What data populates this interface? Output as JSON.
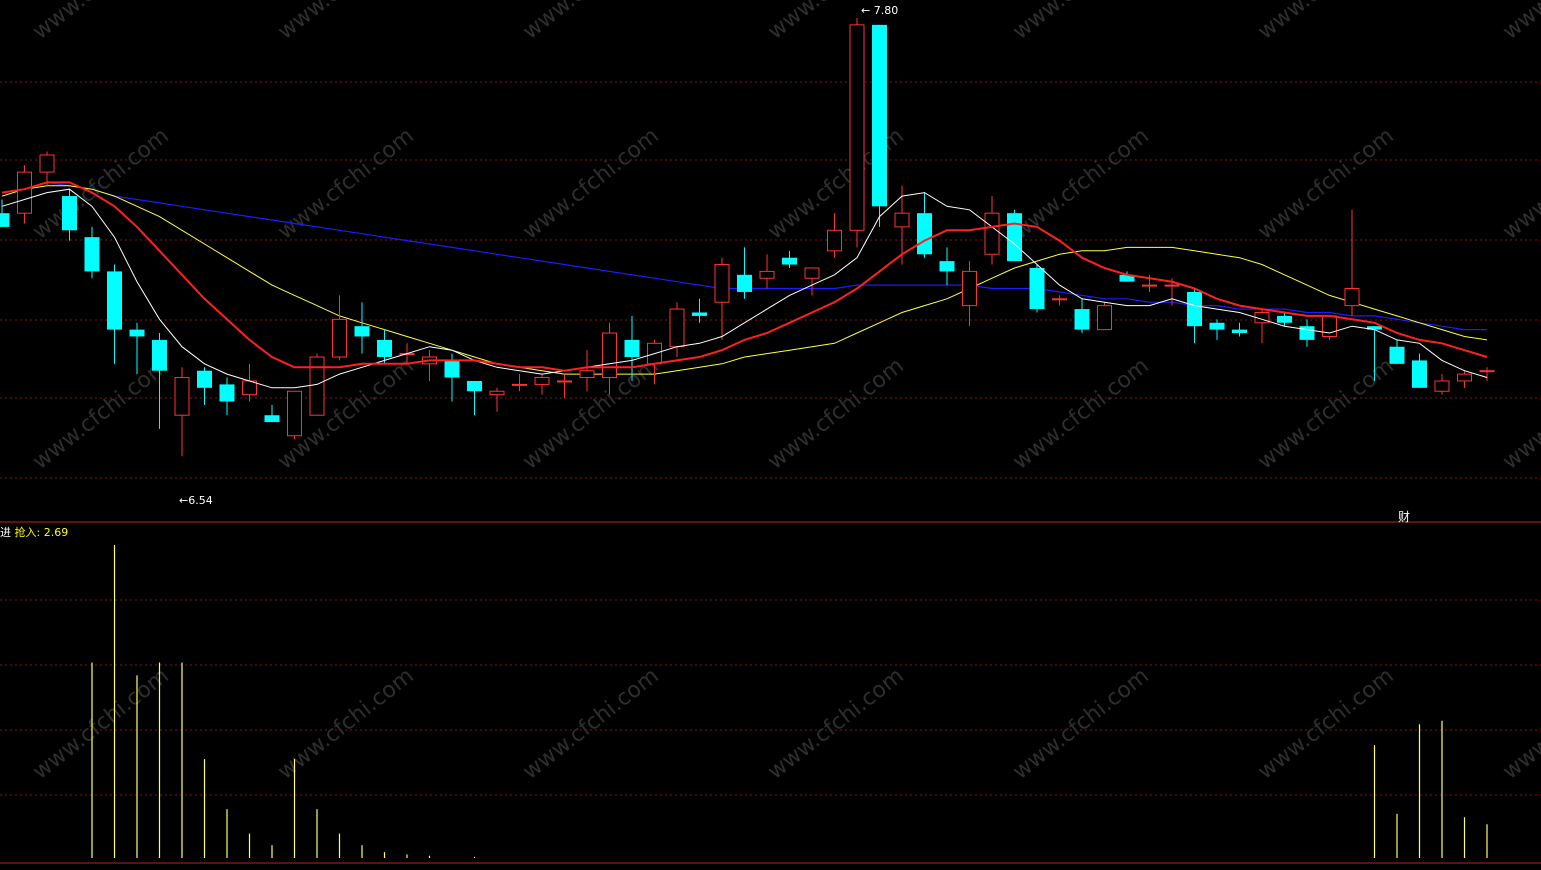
{
  "labels": {
    "indicator_head": "进",
    "indicator_name": "抢入:",
    "indicator_value": "2.69",
    "high_note": "← 7.80",
    "low_note": "←6.54",
    "finance_mark": "财",
    "watermark": "www.cfchi.com"
  },
  "colors": {
    "background": "#000000",
    "up": "#ff3232",
    "down": "#00ffff",
    "ma_white": "#ffffff",
    "ma_red": "#ff2020",
    "ma_yellow": "#ffff40",
    "ma_blue": "#1c1cff",
    "volume_bar": "#ffff66",
    "grid": "#7a1a1a",
    "divider": "#c02020"
  },
  "chart_data": [
    {
      "type": "candlestick",
      "price_range": [
        6.5,
        7.82
      ],
      "candles": [
        {
          "o": 7.25,
          "h": 7.29,
          "l": 7.21,
          "c": 7.21
        },
        {
          "o": 7.25,
          "h": 7.39,
          "l": 7.22,
          "c": 7.37
        },
        {
          "o": 7.37,
          "h": 7.43,
          "l": 7.33,
          "c": 7.42
        },
        {
          "o": 7.3,
          "h": 7.32,
          "l": 7.17,
          "c": 7.2
        },
        {
          "o": 7.18,
          "h": 7.21,
          "l": 7.06,
          "c": 7.08
        },
        {
          "o": 7.08,
          "h": 7.1,
          "l": 6.81,
          "c": 6.91
        },
        {
          "o": 6.91,
          "h": 6.93,
          "l": 6.78,
          "c": 6.89
        },
        {
          "o": 6.88,
          "h": 6.9,
          "l": 6.62,
          "c": 6.79
        },
        {
          "o": 6.66,
          "h": 6.8,
          "l": 6.54,
          "c": 6.77
        },
        {
          "o": 6.79,
          "h": 6.8,
          "l": 6.69,
          "c": 6.74
        },
        {
          "o": 6.75,
          "h": 6.77,
          "l": 6.66,
          "c": 6.7
        },
        {
          "o": 6.72,
          "h": 6.81,
          "l": 6.7,
          "c": 6.76
        },
        {
          "o": 6.66,
          "h": 6.69,
          "l": 6.64,
          "c": 6.64
        },
        {
          "o": 6.6,
          "h": 6.73,
          "l": 6.59,
          "c": 6.73
        },
        {
          "o": 6.66,
          "h": 6.84,
          "l": 6.66,
          "c": 6.83
        },
        {
          "o": 6.83,
          "h": 7.01,
          "l": 6.82,
          "c": 6.94
        },
        {
          "o": 6.92,
          "h": 6.99,
          "l": 6.84,
          "c": 6.89
        },
        {
          "o": 6.88,
          "h": 6.91,
          "l": 6.81,
          "c": 6.83
        },
        {
          "o": 6.84,
          "h": 6.87,
          "l": 6.81,
          "c": 6.84
        },
        {
          "o": 6.81,
          "h": 6.85,
          "l": 6.76,
          "c": 6.83
        },
        {
          "o": 6.82,
          "h": 6.84,
          "l": 6.7,
          "c": 6.77
        },
        {
          "o": 6.76,
          "h": 6.76,
          "l": 6.66,
          "c": 6.73
        },
        {
          "o": 6.72,
          "h": 6.74,
          "l": 6.67,
          "c": 6.73
        },
        {
          "o": 6.75,
          "h": 6.78,
          "l": 6.73,
          "c": 6.75
        },
        {
          "o": 6.75,
          "h": 6.78,
          "l": 6.72,
          "c": 6.77
        },
        {
          "o": 6.76,
          "h": 6.78,
          "l": 6.71,
          "c": 6.76
        },
        {
          "o": 6.77,
          "h": 6.85,
          "l": 6.73,
          "c": 6.79
        },
        {
          "o": 6.77,
          "h": 6.93,
          "l": 6.72,
          "c": 6.9
        },
        {
          "o": 6.88,
          "h": 6.95,
          "l": 6.76,
          "c": 6.83
        },
        {
          "o": 6.81,
          "h": 6.88,
          "l": 6.75,
          "c": 6.87
        },
        {
          "o": 6.86,
          "h": 6.99,
          "l": 6.83,
          "c": 6.97
        },
        {
          "o": 6.96,
          "h": 7.0,
          "l": 6.93,
          "c": 6.95
        },
        {
          "o": 6.99,
          "h": 7.12,
          "l": 6.88,
          "c": 7.1
        },
        {
          "o": 7.07,
          "h": 7.15,
          "l": 7.0,
          "c": 7.02
        },
        {
          "o": 7.06,
          "h": 7.13,
          "l": 7.03,
          "c": 7.08
        },
        {
          "o": 7.12,
          "h": 7.14,
          "l": 7.09,
          "c": 7.1
        },
        {
          "o": 7.06,
          "h": 7.09,
          "l": 7.01,
          "c": 7.09
        },
        {
          "o": 7.14,
          "h": 7.25,
          "l": 7.12,
          "c": 7.2
        },
        {
          "o": 7.2,
          "h": 7.82,
          "l": 7.15,
          "c": 7.8
        },
        {
          "o": 7.8,
          "h": 7.8,
          "l": 7.21,
          "c": 7.27
        },
        {
          "o": 7.21,
          "h": 7.33,
          "l": 7.1,
          "c": 7.25
        },
        {
          "o": 7.25,
          "h": 7.31,
          "l": 7.12,
          "c": 7.13
        },
        {
          "o": 7.11,
          "h": 7.15,
          "l": 7.04,
          "c": 7.08
        },
        {
          "o": 6.98,
          "h": 7.11,
          "l": 6.92,
          "c": 7.08
        },
        {
          "o": 7.13,
          "h": 7.3,
          "l": 7.1,
          "c": 7.25
        },
        {
          "o": 7.25,
          "h": 7.26,
          "l": 7.11,
          "c": 7.11
        },
        {
          "o": 7.09,
          "h": 7.1,
          "l": 6.96,
          "c": 6.97
        },
        {
          "o": 7.0,
          "h": 7.01,
          "l": 6.98,
          "c": 7.0
        },
        {
          "o": 6.97,
          "h": 7.0,
          "l": 6.9,
          "c": 6.91
        },
        {
          "o": 6.91,
          "h": 6.99,
          "l": 6.91,
          "c": 6.98
        },
        {
          "o": 7.07,
          "h": 7.08,
          "l": 7.05,
          "c": 7.05
        },
        {
          "o": 7.04,
          "h": 7.07,
          "l": 7.02,
          "c": 7.04
        },
        {
          "o": 7.04,
          "h": 7.06,
          "l": 6.98,
          "c": 7.04
        },
        {
          "o": 7.02,
          "h": 7.03,
          "l": 6.87,
          "c": 6.92
        },
        {
          "o": 6.93,
          "h": 6.94,
          "l": 6.88,
          "c": 6.91
        },
        {
          "o": 6.91,
          "h": 6.93,
          "l": 6.89,
          "c": 6.9
        },
        {
          "o": 6.93,
          "h": 6.97,
          "l": 6.87,
          "c": 6.96
        },
        {
          "o": 6.95,
          "h": 6.96,
          "l": 6.92,
          "c": 6.93
        },
        {
          "o": 6.92,
          "h": 6.94,
          "l": 6.86,
          "c": 6.88
        },
        {
          "o": 6.89,
          "h": 6.95,
          "l": 6.88,
          "c": 6.95
        },
        {
          "o": 6.98,
          "h": 7.26,
          "l": 6.95,
          "c": 7.03
        },
        {
          "o": 6.92,
          "h": 6.92,
          "l": 6.76,
          "c": 6.91
        },
        {
          "o": 6.86,
          "h": 6.88,
          "l": 6.81,
          "c": 6.81
        },
        {
          "o": 6.82,
          "h": 6.84,
          "l": 6.74,
          "c": 6.74
        },
        {
          "o": 6.73,
          "h": 6.78,
          "l": 6.72,
          "c": 6.76
        },
        {
          "o": 6.76,
          "h": 6.79,
          "l": 6.74,
          "c": 6.78
        },
        {
          "o": 6.79,
          "h": 6.8,
          "l": 6.76,
          "c": 6.79
        }
      ],
      "ma_white": [
        7.27,
        7.29,
        7.31,
        7.32,
        7.27,
        7.18,
        7.05,
        6.94,
        6.86,
        6.81,
        6.78,
        6.76,
        6.74,
        6.74,
        6.75,
        6.78,
        6.8,
        6.82,
        6.84,
        6.86,
        6.85,
        6.82,
        6.8,
        6.79,
        6.78,
        6.79,
        6.8,
        6.81,
        6.82,
        6.84,
        6.86,
        6.87,
        6.89,
        6.93,
        6.97,
        7.01,
        7.04,
        7.07,
        7.12,
        7.24,
        7.3,
        7.31,
        7.27,
        7.26,
        7.21,
        7.16,
        7.1,
        7.04,
        7.0,
        6.99,
        6.98,
        6.98,
        7.0,
        6.98,
        6.97,
        6.96,
        6.94,
        6.92,
        6.91,
        6.9,
        6.92,
        6.91,
        6.88,
        6.87,
        6.82,
        6.79,
        6.77
      ],
      "ma_red": [
        7.31,
        7.32,
        7.34,
        7.34,
        7.31,
        7.27,
        7.21,
        7.14,
        7.07,
        7.0,
        6.94,
        6.88,
        6.83,
        6.8,
        6.8,
        6.8,
        6.81,
        6.81,
        6.81,
        6.82,
        6.82,
        6.82,
        6.81,
        6.8,
        6.8,
        6.79,
        6.8,
        6.8,
        6.8,
        6.81,
        6.82,
        6.83,
        6.85,
        6.88,
        6.9,
        6.93,
        6.96,
        6.99,
        7.03,
        7.08,
        7.13,
        7.17,
        7.2,
        7.2,
        7.21,
        7.22,
        7.21,
        7.17,
        7.12,
        7.09,
        7.07,
        7.06,
        7.05,
        7.03,
        7.0,
        6.98,
        6.97,
        6.96,
        6.95,
        6.95,
        6.94,
        6.93,
        6.9,
        6.88,
        6.87,
        6.85,
        6.83
      ],
      "ma_yellow": [
        7.3,
        7.32,
        7.33,
        7.33,
        7.32,
        7.3,
        7.27,
        7.24,
        7.2,
        7.16,
        7.12,
        7.08,
        7.04,
        7.01,
        6.98,
        6.95,
        6.93,
        6.91,
        6.89,
        6.87,
        6.85,
        6.83,
        6.81,
        6.8,
        6.79,
        6.78,
        6.78,
        6.78,
        6.78,
        6.78,
        6.79,
        6.8,
        6.81,
        6.83,
        6.84,
        6.85,
        6.86,
        6.87,
        6.9,
        6.93,
        6.96,
        6.98,
        7.0,
        7.03,
        7.06,
        7.09,
        7.11,
        7.13,
        7.14,
        7.14,
        7.15,
        7.15,
        7.15,
        7.14,
        7.13,
        7.12,
        7.1,
        7.07,
        7.04,
        7.01,
        6.99,
        6.97,
        6.95,
        6.93,
        6.91,
        6.89,
        6.88
      ],
      "ma_blue": [
        7.31,
        7.32,
        7.34,
        7.33,
        7.32,
        7.3,
        7.29,
        7.28,
        7.27,
        7.26,
        7.25,
        7.24,
        7.23,
        7.22,
        7.21,
        7.2,
        7.19,
        7.18,
        7.17,
        7.16,
        7.15,
        7.14,
        7.13,
        7.12,
        7.11,
        7.1,
        7.09,
        7.08,
        7.07,
        7.06,
        7.05,
        7.04,
        7.03,
        7.03,
        7.03,
        7.03,
        7.03,
        7.03,
        7.04,
        7.04,
        7.04,
        7.04,
        7.04,
        7.04,
        7.03,
        7.03,
        7.03,
        7.02,
        7.01,
        7.0,
        7.0,
        6.99,
        6.99,
        6.98,
        6.98,
        6.97,
        6.97,
        6.97,
        6.96,
        6.96,
        6.95,
        6.95,
        6.94,
        6.93,
        6.92,
        6.91,
        6.91
      ]
    },
    {
      "type": "bar",
      "name": "抢入",
      "range": [
        0,
        2.69
      ],
      "values": [
        0,
        0,
        0,
        0,
        1.68,
        2.69,
        1.57,
        1.68,
        1.68,
        0.85,
        0.42,
        0.21,
        0.11,
        0.85,
        0.42,
        0.21,
        0.11,
        0.05,
        0.03,
        0.02,
        0,
        0.01,
        0,
        0,
        0,
        0,
        0,
        0,
        0,
        0,
        0,
        0,
        0,
        0,
        0,
        0,
        0,
        0,
        0,
        0,
        0,
        0,
        0,
        0,
        0,
        0,
        0,
        0,
        0,
        0,
        0,
        0,
        0,
        0,
        0,
        0,
        0,
        0,
        0,
        0,
        0,
        0.97,
        0.38,
        1.15,
        1.18,
        0.35,
        0.29
      ]
    }
  ]
}
